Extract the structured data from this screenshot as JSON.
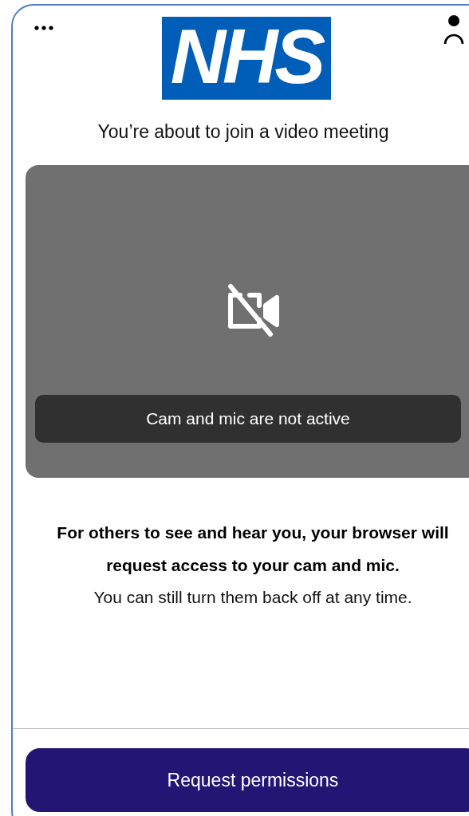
{
  "header": {
    "logo": "NHS"
  },
  "title": "You’re about to join a video meeting",
  "preview": {
    "status": "Cam and mic are not active"
  },
  "notice": {
    "emphasis": "For others to see and hear you, your browser will request access to your cam and mic.",
    "text": "You can still turn them back off at any time."
  },
  "button": "Request permissions"
}
